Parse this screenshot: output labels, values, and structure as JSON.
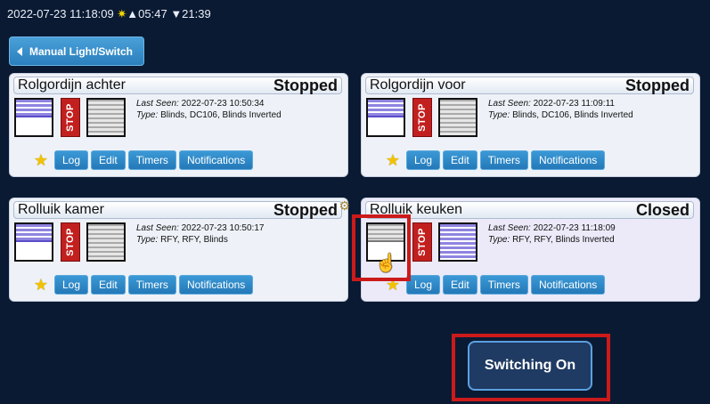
{
  "topbar": {
    "datetime": "2022-07-23 11:18:09",
    "sun_icon": "sun-icon",
    "sunrise": "▲05:47",
    "sunset": "▼21:39"
  },
  "nav": {
    "back_label": "Manual Light/Switch"
  },
  "devices": [
    {
      "name": "Rolgordijn achter",
      "status": "Stopped",
      "last_seen_label": "Last Seen:",
      "last_seen": "2022-07-23 10:50:34",
      "type_label": "Type:",
      "type": "Blinds, DC106, Blinds Inverted"
    },
    {
      "name": "Rolgordijn voor",
      "status": "Stopped",
      "last_seen_label": "Last Seen:",
      "last_seen": "2022-07-23 11:09:11",
      "type_label": "Type:",
      "type": "Blinds, DC106, Blinds Inverted"
    },
    {
      "name": "Rolluik kamer",
      "status": "Stopped",
      "last_seen_label": "Last Seen:",
      "last_seen": "2022-07-23 10:50:17",
      "type_label": "Type:",
      "type": "RFY, RFY, Blinds"
    },
    {
      "name": "Rolluik keuken",
      "status": "Closed",
      "last_seen_label": "Last Seen:",
      "last_seen": "2022-07-23 11:18:09",
      "type_label": "Type:",
      "type": "RFY, RFY, Blinds Inverted"
    }
  ],
  "actions": {
    "stop": "STOP",
    "log": "Log",
    "edit": "Edit",
    "timers": "Timers",
    "notifications": "Notifications"
  },
  "toast": {
    "label": "Switching On"
  },
  "colors": {
    "background": "#0b1a33",
    "button": "#2a7fbd",
    "stop": "#c21f1f",
    "highlight": "#cc1a1a",
    "blind": "#8e84e0"
  }
}
